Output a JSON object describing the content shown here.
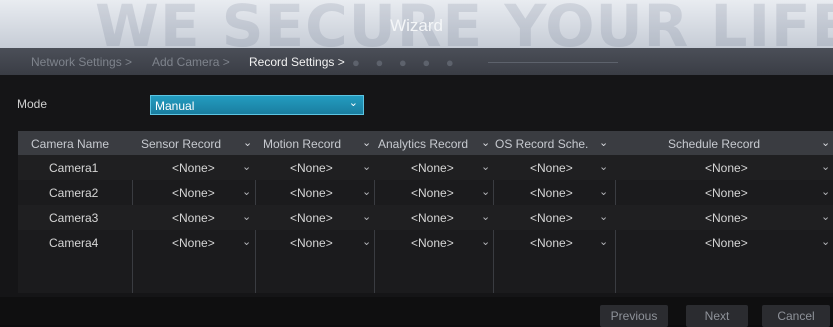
{
  "watermark": "WE SECURE YOUR LIFE",
  "window": {
    "title": "Wizard"
  },
  "steps": [
    {
      "label": "Network Settings >",
      "active": false
    },
    {
      "label": "Add Camera >",
      "active": false
    },
    {
      "label": "Record Settings >",
      "active": true
    }
  ],
  "mode": {
    "label": "Mode",
    "value": "Manual"
  },
  "table": {
    "headers": [
      "Camera Name",
      "Sensor Record",
      "Motion Record",
      "Analytics Record",
      "OS Record Sche.",
      "Schedule Record"
    ],
    "rows": [
      {
        "name": "Camera1",
        "sensor": "<None>",
        "motion": "<None>",
        "analytics": "<None>",
        "os": "<None>",
        "schedule": "<None>"
      },
      {
        "name": "Camera2",
        "sensor": "<None>",
        "motion": "<None>",
        "analytics": "<None>",
        "os": "<None>",
        "schedule": "<None>"
      },
      {
        "name": "Camera3",
        "sensor": "<None>",
        "motion": "<None>",
        "analytics": "<None>",
        "os": "<None>",
        "schedule": "<None>"
      },
      {
        "name": "Camera4",
        "sensor": "<None>",
        "motion": "<None>",
        "analytics": "<None>",
        "os": "<None>",
        "schedule": "<None>"
      }
    ]
  },
  "buttons": {
    "previous": "Previous",
    "next": "Next",
    "cancel": "Cancel"
  },
  "colors": {
    "accent": "#1f8fb3",
    "header_bg": "#3a3c41",
    "panel_bg": "#151517"
  }
}
